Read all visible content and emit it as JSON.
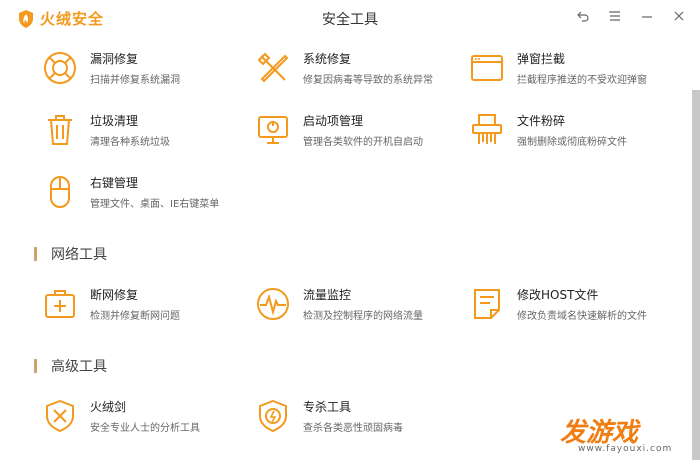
{
  "app": {
    "brand": "火绒安全",
    "title": "安全工具"
  },
  "colors": {
    "accent": "#f39a1e",
    "section_bar": "#c9a26c"
  },
  "system_tools": [
    {
      "name": "漏洞修复",
      "desc": "扫描并修复系统漏洞",
      "icon": "shield-lifebuoy-icon"
    },
    {
      "name": "系统修复",
      "desc": "修复因病毒等导致的系统异常",
      "icon": "wrench-screwdriver-icon"
    },
    {
      "name": "弹窗拦截",
      "desc": "拦截程序推送的不受欢迎弹窗",
      "icon": "window-icon"
    },
    {
      "name": "垃圾清理",
      "desc": "清理各种系统垃圾",
      "icon": "trash-icon"
    },
    {
      "name": "启动项管理",
      "desc": "管理各类软件的开机自启动",
      "icon": "monitor-power-icon"
    },
    {
      "name": "文件粉碎",
      "desc": "强制删除或彻底粉碎文件",
      "icon": "shredder-icon"
    },
    {
      "name": "右键管理",
      "desc": "管理文件、桌面、IE右键菜单",
      "icon": "mouse-icon"
    }
  ],
  "network_section": {
    "label": "网络工具"
  },
  "network_tools": [
    {
      "name": "断网修复",
      "desc": "检测并修复断网问题",
      "icon": "first-aid-kit-icon"
    },
    {
      "name": "流量监控",
      "desc": "检测及控制程序的网络流量",
      "icon": "pulse-icon"
    },
    {
      "name": "修改HOST文件",
      "desc": "修改负责域名快速解析的文件",
      "icon": "document-edit-icon"
    }
  ],
  "advanced_section": {
    "label": "高级工具"
  },
  "advanced_tools": [
    {
      "name": "火绒剑",
      "desc": "安全专业人士的分析工具",
      "icon": "shield-swords-icon"
    },
    {
      "name": "专杀工具",
      "desc": "查杀各类恶性顽固病毒",
      "icon": "shield-bolt-icon"
    }
  ],
  "watermark": {
    "main": "发游戏",
    "sub": "www.fayouxi.com"
  }
}
